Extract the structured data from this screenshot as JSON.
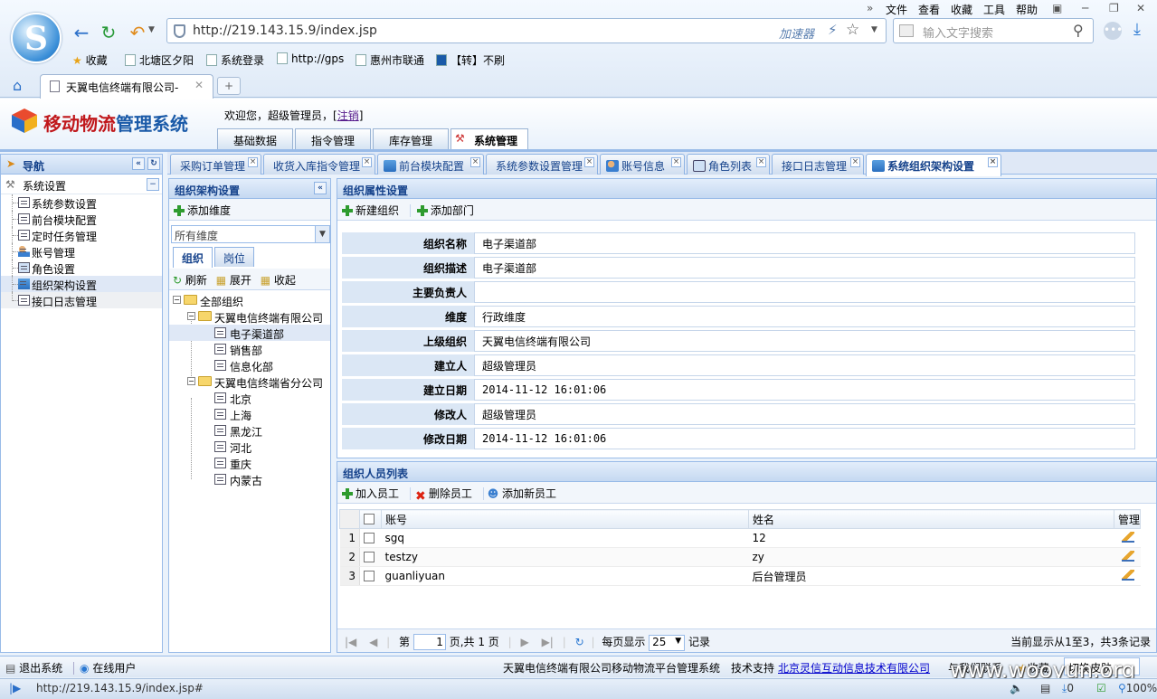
{
  "browser": {
    "menu": [
      "文件",
      "查看",
      "收藏",
      "工具",
      "帮助"
    ],
    "url": "http://219.143.15.9/index.jsp",
    "accelerator": "加速器",
    "search_placeholder": "输入文字搜索",
    "favorites": [
      "收藏",
      "北塘区夕阳",
      "系统登录",
      "http://gps",
      "惠州市联通",
      "【转】不刷"
    ],
    "tab_title": "天翼电信终端有限公司-",
    "status_url": "http://219.143.15.9/index.jsp#",
    "zoom": "100%",
    "status_zero": "0"
  },
  "app": {
    "title_red": "移动物流",
    "title_blue": "管理系统",
    "welcome": "欢迎您，超级管理员，[",
    "logout": "注销",
    "welcome_end": "]",
    "modules": [
      "基础数据",
      "指令管理",
      "库存管理",
      "系统管理"
    ]
  },
  "nav": {
    "title": "导航",
    "section": "系统设置",
    "items": [
      "系统参数设置",
      "前台模块配置",
      "定时任务管理",
      "账号管理",
      "角色设置",
      "组织架构设置",
      "接口日志管理"
    ]
  },
  "tabs": [
    "采购订单管理",
    "收货入库指令管理",
    "前台模块配置",
    "系统参数设置管理",
    "账号信息",
    "角色列表",
    "接口日志管理",
    "系统组织架构设置"
  ],
  "org_panel": {
    "title": "组织架构设置",
    "add_dim": "添加维度",
    "dim_select": "所有维度",
    "subtabs": [
      "组织",
      "岗位"
    ],
    "refresh": "刷新",
    "expand": "展开",
    "collapse": "收起",
    "tree": {
      "root": "全部组织",
      "nodes": [
        {
          "name": "天翼电信终端有限公司",
          "children": [
            "电子渠道部",
            "销售部",
            "信息化部"
          ]
        },
        {
          "name": "天翼电信终端省分公司",
          "children": [
            "北京",
            "上海",
            "黑龙江",
            "河北",
            "重庆",
            "内蒙古"
          ]
        }
      ]
    }
  },
  "attr_panel": {
    "title": "组织属性设置",
    "new_org": "新建组织",
    "add_dept": "添加部门",
    "fields": [
      {
        "label": "组织名称",
        "value": "电子渠道部"
      },
      {
        "label": "组织描述",
        "value": "电子渠道部"
      },
      {
        "label": "主要负责人",
        "value": ""
      },
      {
        "label": "维度",
        "value": "行政维度"
      },
      {
        "label": "上级组织",
        "value": "天翼电信终端有限公司"
      },
      {
        "label": "建立人",
        "value": "超级管理员"
      },
      {
        "label": "建立日期",
        "value": "2014-11-12 16:01:06"
      },
      {
        "label": "修改人",
        "value": "超级管理员"
      },
      {
        "label": "修改日期",
        "value": "2014-11-12 16:01:06"
      }
    ]
  },
  "member_panel": {
    "title": "组织人员列表",
    "add_emp": "加入员工",
    "del_emp": "删除员工",
    "new_emp": "添加新员工",
    "columns": [
      "账号",
      "姓名",
      "管理"
    ],
    "rows": [
      {
        "n": "1",
        "account": "sgq",
        "name": "12"
      },
      {
        "n": "2",
        "account": "testzy",
        "name": "zy"
      },
      {
        "n": "3",
        "account": "guanliyuan",
        "name": "后台管理员"
      }
    ],
    "pager": {
      "page_prefix": "第",
      "page": "1",
      "page_suffix": "页,共 1 页",
      "per_page_label": "每页显示",
      "per_page": "25",
      "records": "记录",
      "summary": "当前显示从1至3，共3条记录"
    }
  },
  "footer": {
    "logout": "退出系统",
    "online": "在线用户",
    "company": "天翼电信终端有限公司移动物流平台管理系统",
    "tech": "技术支持",
    "tech_link": "北京灵信互动信息技术有限公司",
    "contact": "与我们联系",
    "fav": "收藏",
    "skin": "切换皮肤",
    "watermark": "www.wooyun.org"
  }
}
